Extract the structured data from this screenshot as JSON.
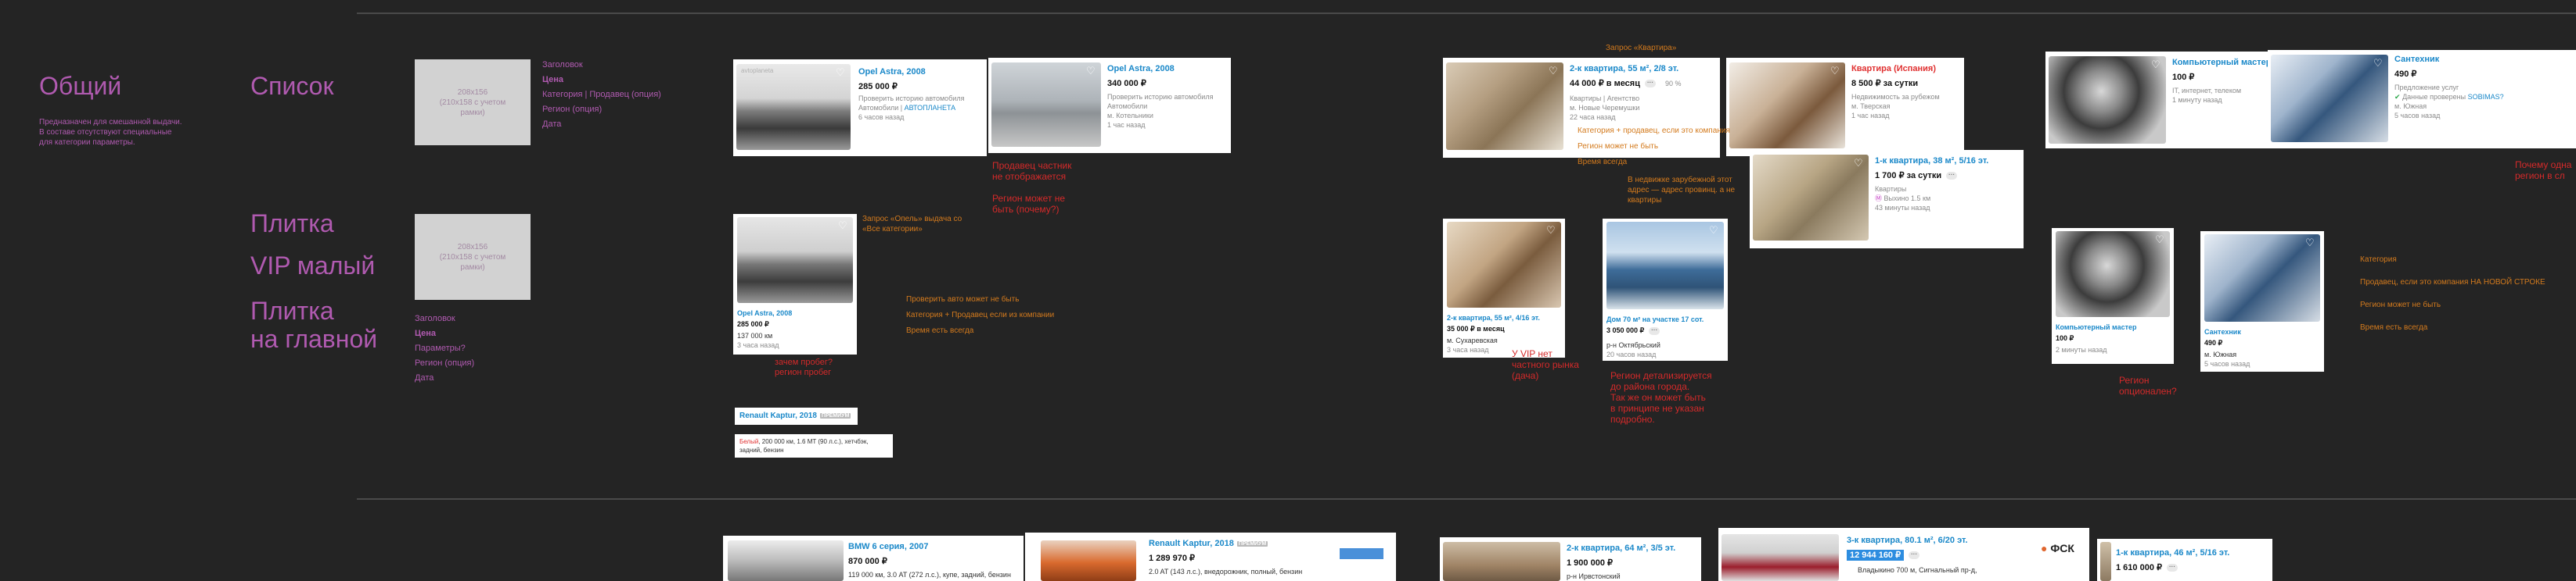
{
  "sections": {
    "general": {
      "title": "Общий",
      "desc": [
        "Предназначен для смешанной выдачи.",
        "В составе отсутствуют специальные",
        "для категории параметры."
      ]
    },
    "list": {
      "title": "Список"
    },
    "tile": {
      "title": "Плитка"
    },
    "vip_small": {
      "title": "VIP малый"
    },
    "tile_main": {
      "title_line1": "Плитка",
      "title_line2": "на главной"
    }
  },
  "placeholders": {
    "list": {
      "line1": "208x156",
      "line2": "(210x158 с учетом",
      "line3": "рамки)"
    },
    "tile": {
      "line1": "208x156",
      "line2": "(210x158 с учетом",
      "line3": "рамки)"
    }
  },
  "fields_list": [
    "Заголовок",
    "Цена",
    "Категория | Продавец (опция)",
    "Регион (опция)",
    "Дата"
  ],
  "fields_tile": [
    "Заголовок",
    "Цена",
    "Параметры?",
    "Регион (опция)",
    "Дата"
  ],
  "cars": {
    "list1": {
      "title": "Opel Astra, 2008",
      "price": "285 000 ₽",
      "sub1": "Проверить историю автомобиля",
      "sub2": "Автомобили | ",
      "seller": "АВТОПЛАНЕТА",
      "date": "6 часов назад",
      "watermark": "avtoplaneta"
    },
    "list2": {
      "title": "Opel Astra, 2008",
      "price": "340 000 ₽",
      "sub1": "Проверить историю автомобиля",
      "sub2": "Автомобили",
      "region": "м. Котельники",
      "date": "1 час назад"
    },
    "tile": {
      "title": "Opel Astra, 2008",
      "price": "285 000 ₽",
      "mileage": "137 000 км",
      "date": "3 часа назад"
    },
    "vip": {
      "title": "Renault Kaptur, 2018",
      "tag": "ПРЕМИУМ",
      "params": "200 000 км, 1.6 MT (90 л.с.), хетчбэк, задний, бензин",
      "color_word": "Белый"
    }
  },
  "notes": {
    "list_red": [
      "Продавец частник",
      "не отображается",
      "",
      "Регион может не",
      "быть (почему?)"
    ],
    "tile_orange1": [
      "Запрос «Опель» выдача со",
      "«Все категории»"
    ],
    "tile_orange2": [
      "Проверить авто может не быть",
      "Категория + Продавец если из компании",
      "Время есть всегда"
    ],
    "tile_red": [
      "зачем пробег?",
      "регион пробег"
    ],
    "re_query": "Запрос «Квартира»",
    "re_orange1": [
      "Категория + продавец, если это компания",
      "Регион может не быть",
      "Время всегда"
    ],
    "re_orange2": [
      "В недвижке зарубежной этот",
      "адрес — адрес провинц. а не",
      "квартиры"
    ],
    "re_red_vip": [
      "У VIP нет",
      "частного рынка",
      "(дача)"
    ],
    "re_red_region": [
      "Регион детализируется",
      "до района города.",
      "Так же он может быть",
      "в принципе не указан",
      "подробно."
    ],
    "svc_orange": [
      "Категория",
      "Продавец, если это компания НА НОВОЙ СТРОКЕ",
      "Регион может не быть",
      "Время есть всегда"
    ],
    "svc_red1": "Регион опционален?",
    "svc_red_right": [
      "Почему одна",
      "регион в сл"
    ]
  },
  "realty": {
    "list1": {
      "title": "2-к квартира, 55 м², 2/8 эт.",
      "price": "44 000 ₽ в месяц",
      "extra": "90 %",
      "sub1": "Квартиры | Агентство",
      "sub2": "м. Новые Черемушки",
      "date": "22 часа назад"
    },
    "list2": {
      "title": "Квартира (Испания)",
      "price": "8 500 ₽ за сутки",
      "sub1": "Недвижимость за рубежом",
      "sub2": "м. Тверская",
      "date": "1 час назад"
    },
    "list3": {
      "title": "1-к квартира, 38 м², 5/16 эт.",
      "price": "1 700 ₽ за сутки",
      "sub1": "Квартиры",
      "sub2": "Выхино 1.5 км",
      "date": "43 минуты назад"
    },
    "tile1": {
      "title": "2-к квартира, 55 м², 4/16 эт.",
      "price": "35 000 ₽ в месяц",
      "region": "м. Сухаревская",
      "date": "3 часа назад"
    },
    "tile2": {
      "title": "Дом 70 м² на участке 17 сот.",
      "price": "3 050 000 ₽",
      "region": "р-н Октябрьский",
      "date": "20 часов назад"
    }
  },
  "services": {
    "list1": {
      "title": "Компьютерный мастер",
      "price": "100 ₽",
      "sub1": "IT, интернет, телеком",
      "date": "1 минуту назад"
    },
    "list2": {
      "title": "Сантехник",
      "price": "490 ₽",
      "sub1": "Предложение услуг",
      "sub2": "Данные проверены",
      "seller": "SOBIMAS?",
      "region": "м. Южная",
      "date": "5 часов назад"
    },
    "tile1": {
      "title": "Компьютерный мастер",
      "price": "100 ₽",
      "date": "2 минуты назад"
    },
    "tile2": {
      "title": "Сантехник",
      "price": "490 ₽",
      "region": "м. Южная",
      "date": "5 часов назад"
    }
  },
  "bottom": {
    "bmw": {
      "title": "BMW 6 серия, 2007",
      "price": "870 000 ₽",
      "params": "119 000 км, 3.0 AT (272 л.с.), купе, задний, бензин"
    },
    "renault": {
      "title": "Renault Kaptur, 2018",
      "tag": "ПРЕМИУМ",
      "price": "1 289 970 ₽",
      "params": "2.0 AT (143 л.с.), внедорожник, полный, бензин"
    },
    "flat2": {
      "title": "2-к квартира, 64 м², 3/5 эт.",
      "price": "1 900 000 ₽",
      "region": "р-н Ирвстонский"
    },
    "flat3": {
      "title": "3-к квартира, 80.1 м², 6/20 эт.",
      "price": "12 944 160 ₽",
      "region": "Владыкино 700 м, Сигнальный пр-д,",
      "logo": "ФСК"
    },
    "flat1": {
      "title": "1-к квартира, 46 м², 5/16 эт.",
      "price": "1 610 000 ₽"
    }
  },
  "colors": {
    "bg": "#242424",
    "section": "#b05ab0",
    "link": "#1a88c9",
    "note_orange": "#d37a1d",
    "note_red": "#d42a2a"
  }
}
